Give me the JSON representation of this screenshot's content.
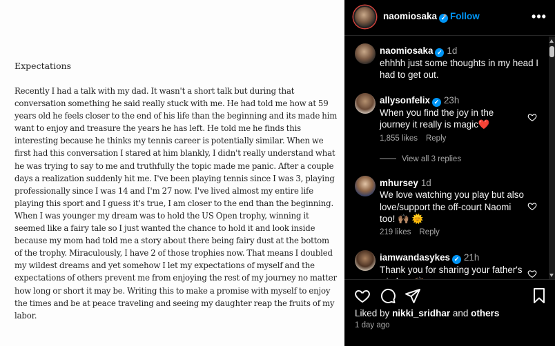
{
  "note": {
    "title": "Expectations",
    "body": "Recently I had a talk with my dad. It wasn't a short talk but during that conversation something he said really stuck with me. He had told me how at 59 years old he feels closer to the end of his life than the beginning and its made him want to enjoy and treasure the years he has left. He told me he finds this interesting because he thinks my tennis career is potentially similar. When we first had this conversation I stared at him blankly, I didn't really understand what he was trying to say to me and truthfully the topic made me panic. After a couple days a realization suddenly hit me. I've been playing tennis since I was 3, playing professionally since I was 14 and I'm 27 now. I've lived almost my entire life playing this sport and I guess it's true, I am closer to the end than the beginning. When I was younger my dream was to hold the US Open trophy, winning it seemed like a fairy tale so I just wanted the chance to hold it and look inside because my mom had told me a story about there being fairy dust at the bottom of the trophy. Miraculously, I have 2 of those trophies now. That means I doubled my wildest dreams and yet somehow I let my expectations of myself and the expectations of others prevent me from enjoying the rest of my journey no matter how long or short it may be. Writing this to make a promise with myself to enjoy the times and be at peace traveling and seeing my daughter reap the fruits of my labor."
  },
  "header": {
    "username": "naomiosaka",
    "separator": "•",
    "follow_label": "Follow",
    "more_glyph": "•••"
  },
  "verified_glyph": "✓",
  "comments": [
    {
      "username": "naomiosaka",
      "verified": true,
      "time": "1d",
      "text": "ehhhh just some thoughts in my head I had to get out."
    },
    {
      "username": "allysonfelix",
      "verified": true,
      "time": "23h",
      "text": "When you find the joy in the journey it really is magic❤️",
      "likes": "1,855 likes",
      "reply_label": "Reply",
      "view_replies": "View all 3 replies"
    },
    {
      "username": "mhursey",
      "verified": false,
      "time": "1d",
      "text": "We love watching you play but also love/support the off-court Naomi too! 🙌🏽 🌞",
      "likes": "219 likes",
      "reply_label": "Reply"
    },
    {
      "username": "iamwandasykes",
      "verified": true,
      "time": "21h",
      "text": "Thank you for sharing your father's wisdom 🙌🏽"
    }
  ],
  "footer": {
    "liked_by_prefix": "Liked by",
    "liked_by_user": "nikki_sridhar",
    "liked_by_and": "and",
    "liked_by_others": "others",
    "time_ago": "1 day ago"
  },
  "colors": {
    "follow": "#0095f6",
    "verified": "#0095f6",
    "panel_bg": "#000000",
    "muted_text": "#a8a8a8"
  },
  "icons": [
    "more-icon",
    "heart-icon",
    "comment-icon",
    "share-icon",
    "bookmark-icon",
    "verified-badge-icon"
  ]
}
